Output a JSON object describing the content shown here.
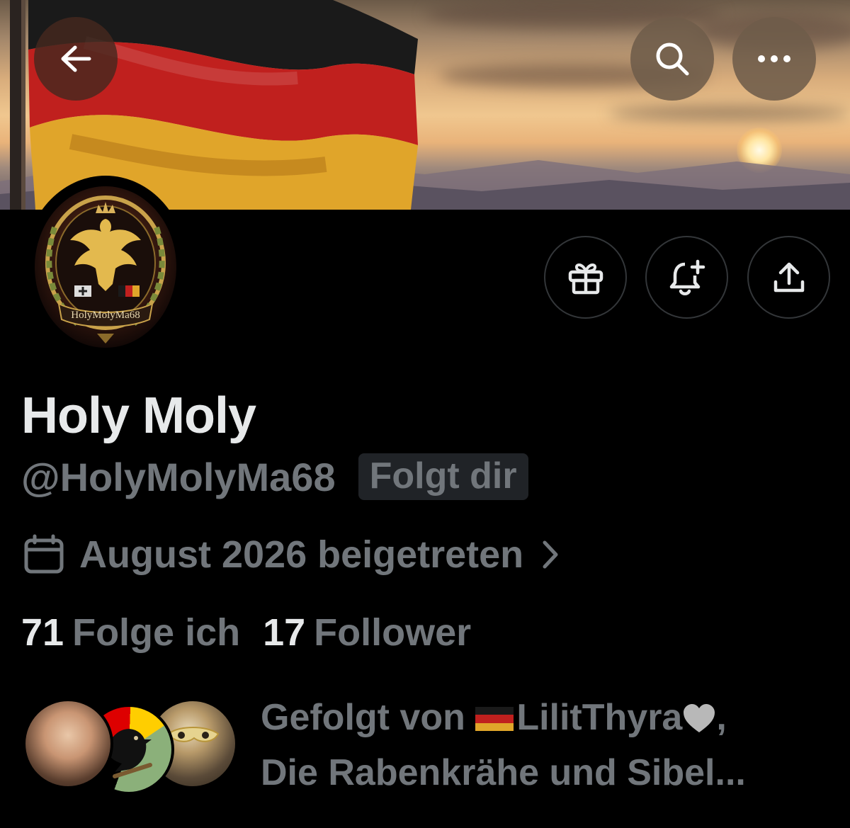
{
  "profile": {
    "display_name": "Holy Moly",
    "handle": "@HolyMolyMa68",
    "follows_you_badge": "Folgt dir",
    "avatar_text": "HolyMolyMa68",
    "joined": "August 2026 beigetreten",
    "following_count": "71",
    "following_label": "Folge ich",
    "followers_count": "17",
    "followers_label": "Follower"
  },
  "followed_by": {
    "prefix": "Gefolgt von ",
    "name1": "LilitThyra",
    "sep": ",",
    "line2": "Die Rabenkrähe und Sibel..."
  },
  "icons": {
    "back": "arrow-left-icon",
    "search": "search-icon",
    "more": "more-horizontal-icon",
    "gift": "gift-icon",
    "notify": "bell-plus-icon",
    "share": "share-upload-icon",
    "calendar": "calendar-icon",
    "chevron": "chevron-right-icon",
    "heart": "grey-heart-icon",
    "flag": "germany-flag-icon"
  },
  "colors": {
    "background": "#000000",
    "primary_text": "#e7e9ea",
    "secondary_text": "#71767b",
    "badge_bg": "#202327",
    "button_border": "#333639",
    "flag_black": "#1a1a1a",
    "flag_red": "#c0201e",
    "flag_gold": "#e0a52a"
  }
}
